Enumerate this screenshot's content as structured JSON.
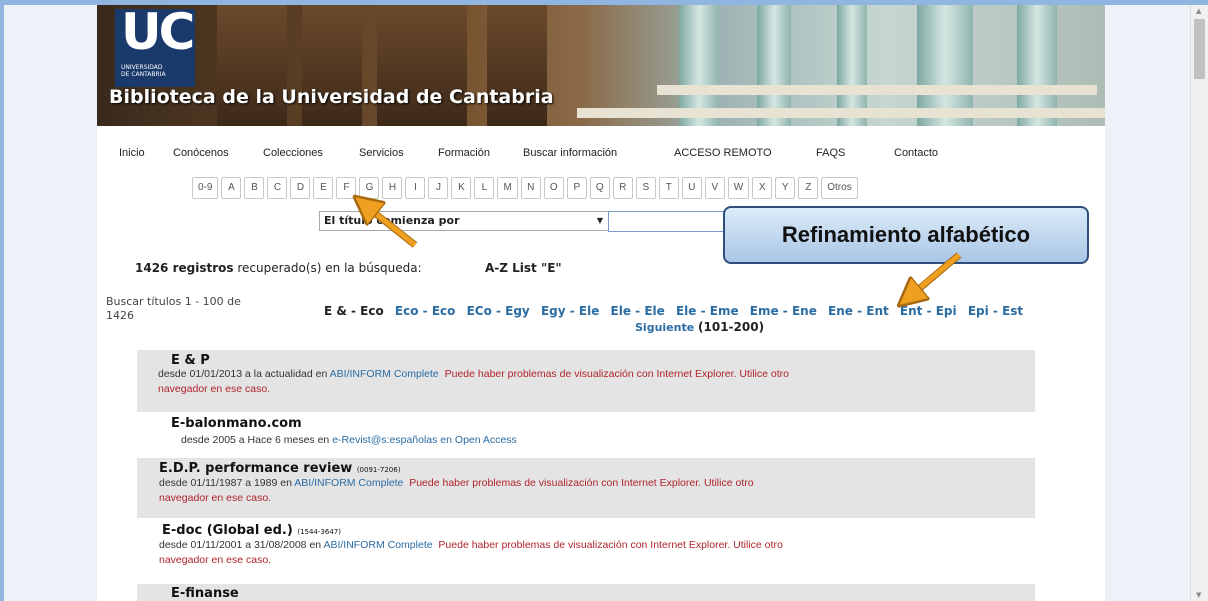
{
  "banner": {
    "logo_letters": "UC",
    "logo_sub_1": "UNIVERSIDAD",
    "logo_sub_2": "DE CANTABRIA",
    "site_title": "Biblioteca de la Universidad de Cantabria"
  },
  "nav": [
    "Inicio",
    "Conócenos",
    "Colecciones",
    "Servicios",
    "Formación",
    "Buscar información",
    "ACCESO REMOTO",
    "FAQS",
    "Contacto"
  ],
  "letters": [
    "0-9",
    "A",
    "B",
    "C",
    "D",
    "E",
    "F",
    "G",
    "H",
    "I",
    "J",
    "K",
    "L",
    "M",
    "N",
    "O",
    "P",
    "Q",
    "R",
    "S",
    "T",
    "U",
    "V",
    "W",
    "X",
    "Y",
    "Z",
    "Otros"
  ],
  "search": {
    "select_value": "El título comienza por",
    "input_value": ""
  },
  "summary": {
    "count": "1426 registros",
    "text": " recuperado(s) en la búsqueda:",
    "az": "A-Z List \"E\""
  },
  "browse": {
    "line1": "Buscar títulos 1 - 100 de",
    "line2": "1426"
  },
  "ranges": [
    {
      "label": "E & - Eco",
      "current": true
    },
    {
      "label": "Eco - Eco",
      "current": false
    },
    {
      "label": "ECo - Egy",
      "current": false
    },
    {
      "label": "Egy - Ele",
      "current": false
    },
    {
      "label": "Ele - Ele",
      "current": false
    },
    {
      "label": "Ele - Eme",
      "current": false
    },
    {
      "label": "Eme - Ene",
      "current": false
    },
    {
      "label": "Ene - Ent",
      "current": false
    },
    {
      "label": "Ent - Epi",
      "current": false
    },
    {
      "label": "Epi - Est",
      "current": false
    }
  ],
  "next": {
    "label": "Siguiente",
    "range": "(101-200)"
  },
  "records": [
    {
      "title": "E & P",
      "issn": "",
      "coverage": "desde 01/01/2013 a la actualidad en ",
      "database": "ABI/INFORM Complete",
      "warning_1": "Puede haber problemas de visualización con Internet Explorer. Utilice otro",
      "warning_2": "navegador en ese caso."
    },
    {
      "title": "E-balonmano.com",
      "issn": "",
      "coverage": "desde 2005 a Hace 6 meses en ",
      "database": "e-Revist@s:españolas en Open Access",
      "warning_1": "",
      "warning_2": ""
    },
    {
      "title": "E.D.P. performance review",
      "issn": "(0091-7206)",
      "coverage": "desde 01/11/1987 a 1989 en ",
      "database": "ABI/INFORM Complete",
      "warning_1": "Puede haber problemas de visualización con Internet Explorer. Utilice otro",
      "warning_2": "navegador en ese caso."
    },
    {
      "title": "E-doc (Global ed.)",
      "issn": "(1544-3647)",
      "coverage": "desde 01/11/2001 a 31/08/2008 en ",
      "database": "ABI/INFORM Complete",
      "warning_1": "Puede haber problemas de visualización con Internet Explorer. Utilice otro",
      "warning_2": "navegador en ese caso."
    },
    {
      "title": "E-finanse",
      "issn": "",
      "coverage": "",
      "database": "",
      "warning_1": "",
      "warning_2": ""
    }
  ],
  "callout": "Refinamiento alfabético",
  "colors": {
    "link": "#2b6ca3",
    "warning": "#b0242b",
    "callout_arrow": "#f0a020",
    "logo_bg": "#1a3a6b"
  }
}
